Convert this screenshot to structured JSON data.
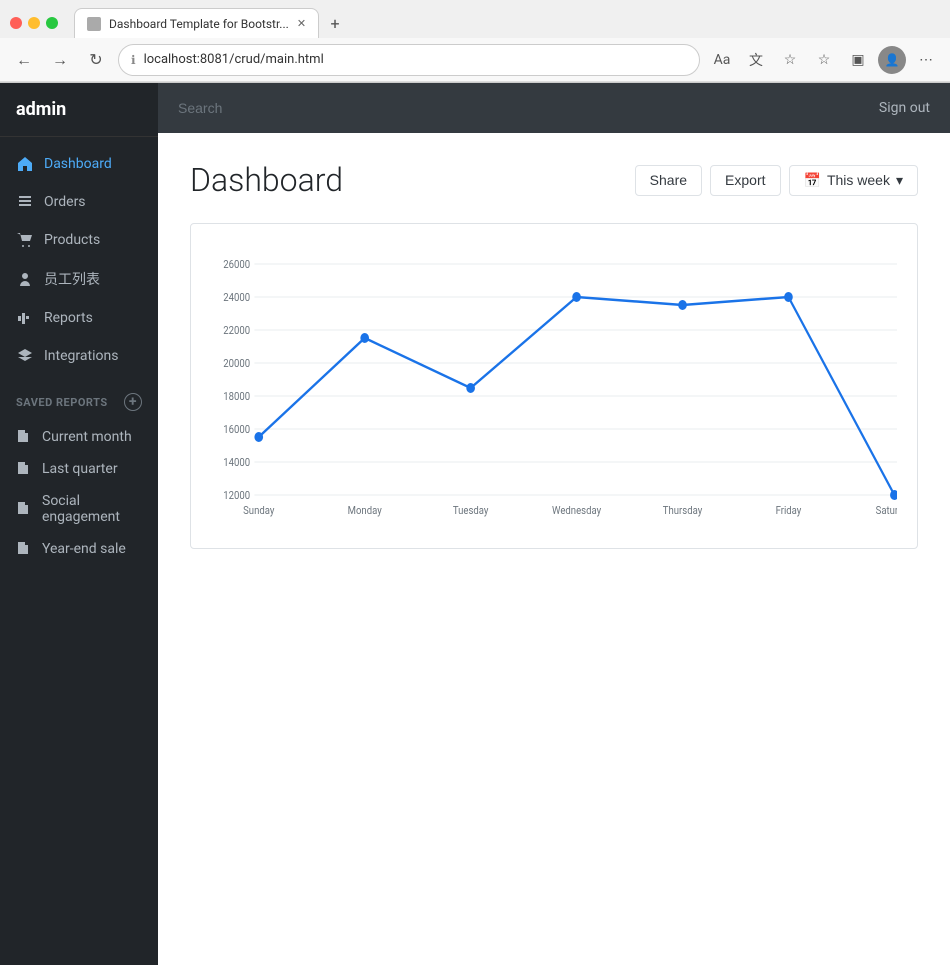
{
  "browser": {
    "tab_title": "Dashboard Template for Bootstr...",
    "url": "localhost:8081/crud/main.html",
    "new_tab_label": "+",
    "nav_back": "←",
    "nav_forward": "→",
    "nav_refresh": "↻"
  },
  "sidebar": {
    "brand": "admin",
    "nav_items": [
      {
        "id": "dashboard",
        "label": "Dashboard",
        "icon": "home",
        "active": true
      },
      {
        "id": "orders",
        "label": "Orders",
        "icon": "orders"
      },
      {
        "id": "products",
        "label": "Products",
        "icon": "cart"
      },
      {
        "id": "employees",
        "label": "员工列表",
        "icon": "person"
      },
      {
        "id": "reports",
        "label": "Reports",
        "icon": "bar-chart"
      },
      {
        "id": "integrations",
        "label": "Integrations",
        "icon": "layers"
      }
    ],
    "saved_reports_label": "SAVED REPORTS",
    "saved_reports": [
      {
        "id": "current-month",
        "label": "Current month"
      },
      {
        "id": "last-quarter",
        "label": "Last quarter"
      },
      {
        "id": "social-engagement",
        "label": "Social engagement"
      },
      {
        "id": "year-end-sale",
        "label": "Year-end sale"
      }
    ]
  },
  "topbar": {
    "search_placeholder": "Search",
    "sign_out_label": "Sign out"
  },
  "content": {
    "page_title": "Dashboard",
    "share_label": "Share",
    "export_label": "Export",
    "this_week_label": "This week",
    "chart": {
      "y_labels": [
        "26000",
        "24000",
        "22000",
        "20000",
        "18000",
        "16000",
        "14000",
        "12000"
      ],
      "x_labels": [
        "Sunday",
        "Monday",
        "Tuesday",
        "Wednesday",
        "Thursday",
        "Friday",
        "Saturday"
      ],
      "data_points": [
        15500,
        21500,
        18500,
        24000,
        23500,
        24000,
        12000
      ]
    }
  }
}
